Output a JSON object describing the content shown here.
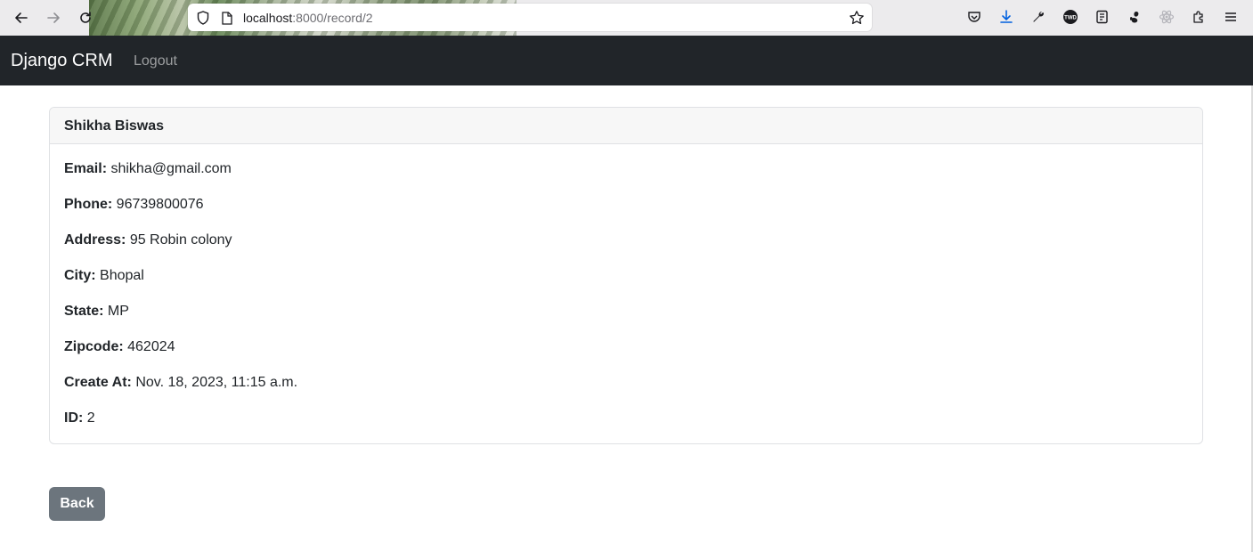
{
  "browser": {
    "url_host": "localhost",
    "url_path": ":8000/record/2"
  },
  "navbar": {
    "brand": "Django CRM",
    "logout_label": "Logout"
  },
  "record": {
    "title": "Shikha Biswas",
    "fields": [
      {
        "label": "Email:",
        "value": "shikha@gmail.com"
      },
      {
        "label": "Phone:",
        "value": "96739800076"
      },
      {
        "label": "Address:",
        "value": "95 Robin colony"
      },
      {
        "label": "City:",
        "value": "Bhopal"
      },
      {
        "label": "State:",
        "value": "MP"
      },
      {
        "label": "Zipcode:",
        "value": "462024"
      },
      {
        "label": "Create At:",
        "value": "Nov. 18, 2023, 11:15 a.m."
      },
      {
        "label": "ID:",
        "value": "2"
      }
    ]
  },
  "back_button": {
    "label": "Back"
  },
  "toolbar_icons": [
    "pocket-icon",
    "download-icon",
    "wrench-icon",
    "twd-extension-icon",
    "reader-icon",
    "gnome-extension-icon",
    "react-devtools-icon",
    "extensions-icon",
    "menu-icon"
  ],
  "colors": {
    "navbar_bg": "#212529",
    "button_secondary": "#6c757d",
    "download_accent": "#0060df"
  }
}
